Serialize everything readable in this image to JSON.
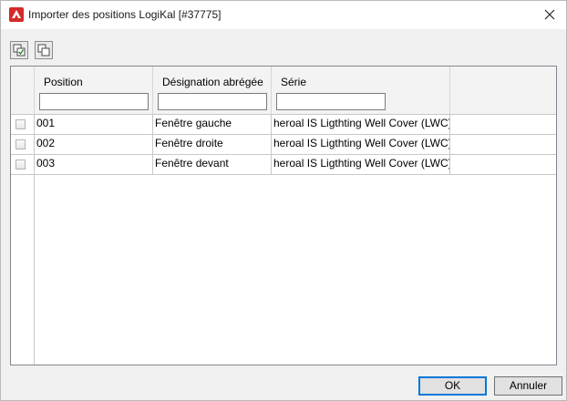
{
  "window": {
    "title": "Importer des positions LogiKal [#37775]"
  },
  "icons": {
    "app": "logikal-app-icon",
    "close": "close-icon",
    "toolbar": [
      "select-all-icon",
      "deselect-all-icon"
    ]
  },
  "grid": {
    "columns": [
      {
        "label": "Position",
        "filter": ""
      },
      {
        "label": "Désignation abrégée",
        "filter": ""
      },
      {
        "label": "Série",
        "filter": ""
      }
    ],
    "rows": [
      {
        "checked": false,
        "position": "001",
        "designation": "Fenêtre gauche",
        "serie": "heroal IS Ligthting Well Cover (LWC)"
      },
      {
        "checked": false,
        "position": "002",
        "designation": "Fenêtre droite",
        "serie": "heroal IS Ligthting Well Cover (LWC)"
      },
      {
        "checked": false,
        "position": "003",
        "designation": "Fenêtre devant",
        "serie": "heroal IS Ligthting Well Cover (LWC)"
      }
    ]
  },
  "buttons": {
    "ok": "OK",
    "cancel": "Annuler"
  },
  "colors": {
    "accent": "#0078d7",
    "brand_red": "#d42a2a"
  }
}
